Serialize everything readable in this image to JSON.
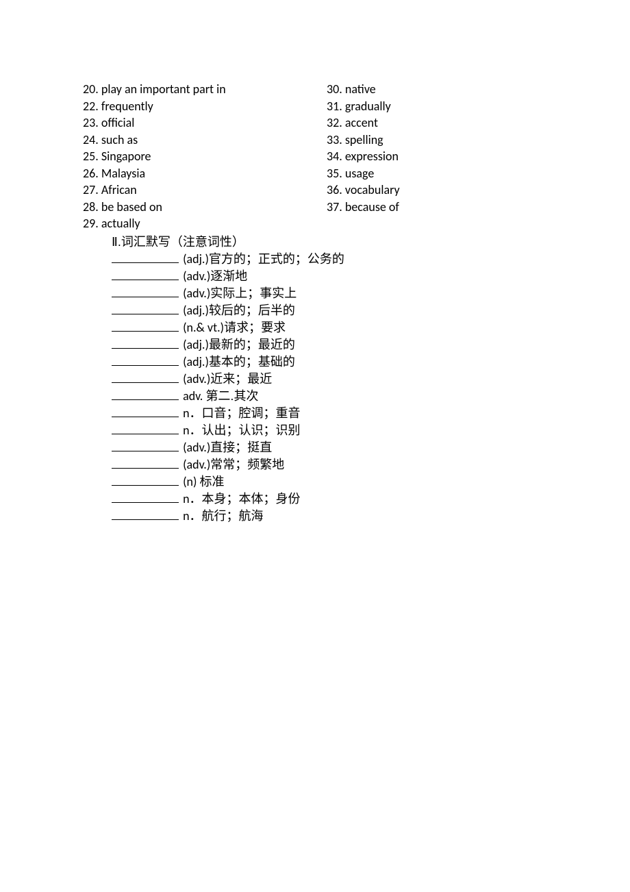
{
  "leftColumn": [
    {
      "num": "20.",
      "text": "play an important part in"
    },
    {
      "num": "22.",
      "text": "frequently"
    },
    {
      "num": "23.",
      "text": "official"
    },
    {
      "num": "24.",
      "text": "such as"
    },
    {
      "num": "25.",
      "text": "Singapore"
    },
    {
      "num": "26.",
      "text": "Malaysia"
    },
    {
      "num": "27.",
      "text": "African"
    },
    {
      "num": "28.",
      "text": "be based on"
    },
    {
      "num": "29.",
      "text": "actually"
    }
  ],
  "rightColumn": [
    {
      "num": "30.",
      "text": "native"
    },
    {
      "num": "31.",
      "text": "gradually"
    },
    {
      "num": "32.",
      "text": "accent"
    },
    {
      "num": "33.",
      "text": "spelling"
    },
    {
      "num": "34.",
      "text": "expression"
    },
    {
      "num": "35.",
      "text": "usage"
    },
    {
      "num": "36.",
      "text": "vocabulary"
    },
    {
      "num": "37.",
      "text": "because of"
    }
  ],
  "section2Title": {
    "roman": "Ⅱ",
    "cjk": ".词汇默写（注意词性）"
  },
  "fillItems": [
    {
      "pos": "(adj.)",
      "def": "官方的；正式的；公务的"
    },
    {
      "pos": "(adv.)",
      "def": "逐渐地"
    },
    {
      "pos": "(adv.)",
      "def": "实际上；事实上"
    },
    {
      "pos": "(adj.)",
      "def": "较后的；后半的"
    },
    {
      "pos": "(n.& vt.)",
      "def": "请求；要求"
    },
    {
      "pos": "(adj.)",
      "def": "最新的；最近的"
    },
    {
      "pos": "(adj.)",
      "def": "基本的；基础的"
    },
    {
      "pos": "(adv.)",
      "def": "近来；最近"
    },
    {
      "pos": "adv.",
      "def": "第二.其次"
    },
    {
      "pos": "n．",
      "def": "口音；腔调；重音"
    },
    {
      "pos": "n．",
      "def": "认出；认识；识别"
    },
    {
      "pos": "(adv.)",
      "def": "直接；挺直"
    },
    {
      "pos": "(adv.)",
      "def": "常常；频繁地"
    },
    {
      "pos": "(n)",
      "def": "标准"
    },
    {
      "pos": "n．",
      "def": "本身；本体；身份"
    },
    {
      "pos": "n．",
      "def": "航行；航海"
    }
  ]
}
